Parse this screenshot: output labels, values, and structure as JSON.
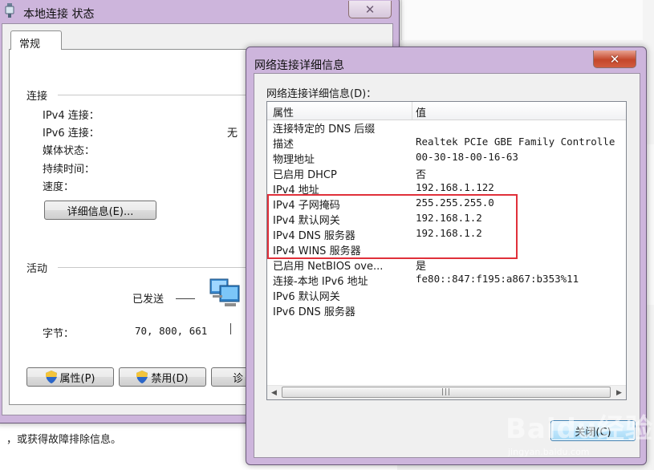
{
  "background": {
    "hint_text": "，或获得故障排除信息。"
  },
  "status_window": {
    "title": "本地连接 状态",
    "tab_general": "常规",
    "connection": {
      "heading": "连接",
      "ipv4_label": "IPv4 连接：",
      "ipv6_label": "IPv6 连接：",
      "ipv6_value": "无",
      "media_label": "媒体状态：",
      "duration_label": "持续时间：",
      "speed_label": "速度：",
      "details_button": "详细信息(E)..."
    },
    "activity": {
      "heading": "活动",
      "sent_label": "已发送",
      "bytes_label": "字节：",
      "bytes_sent": "70, 800, 661"
    },
    "buttons": {
      "properties": "属性(P)",
      "disable": "禁用(D)",
      "diagnose": "诊"
    }
  },
  "details_window": {
    "title": "网络连接详细信息",
    "list_label": "网络连接详细信息(D)：",
    "columns": {
      "property": "属性",
      "value": "值"
    },
    "rows": [
      {
        "property": "连接特定的 DNS 后缀",
        "value": ""
      },
      {
        "property": "描述",
        "value": "Realtek PCIe GBE Family Controlle"
      },
      {
        "property": "物理地址",
        "value": "00-30-18-00-16-63"
      },
      {
        "property": "已启用 DHCP",
        "value": "否"
      },
      {
        "property": "IPv4 地址",
        "value": "192.168.1.122"
      },
      {
        "property": "IPv4 子网掩码",
        "value": "255.255.255.0"
      },
      {
        "property": "IPv4 默认网关",
        "value": "192.168.1.2"
      },
      {
        "property": "IPv4 DNS 服务器",
        "value": "192.168.1.2"
      },
      {
        "property": "IPv4 WINS 服务器",
        "value": ""
      },
      {
        "property": "已启用 NetBIOS ove...",
        "value": "是"
      },
      {
        "property": "连接-本地 IPv6 地址",
        "value": "fe80::847:f195:a867:b353%11"
      },
      {
        "property": "IPv6 默认网关",
        "value": ""
      },
      {
        "property": "IPv6 DNS 服务器",
        "value": ""
      }
    ],
    "close_button": "关闭(C)"
  },
  "watermark": {
    "brand": "Baidu经验",
    "url": "jingyan.baidu.com"
  },
  "colors": {
    "highlight": "#e0303a",
    "frame": "#cdb5dc",
    "close": "#c4472b"
  }
}
